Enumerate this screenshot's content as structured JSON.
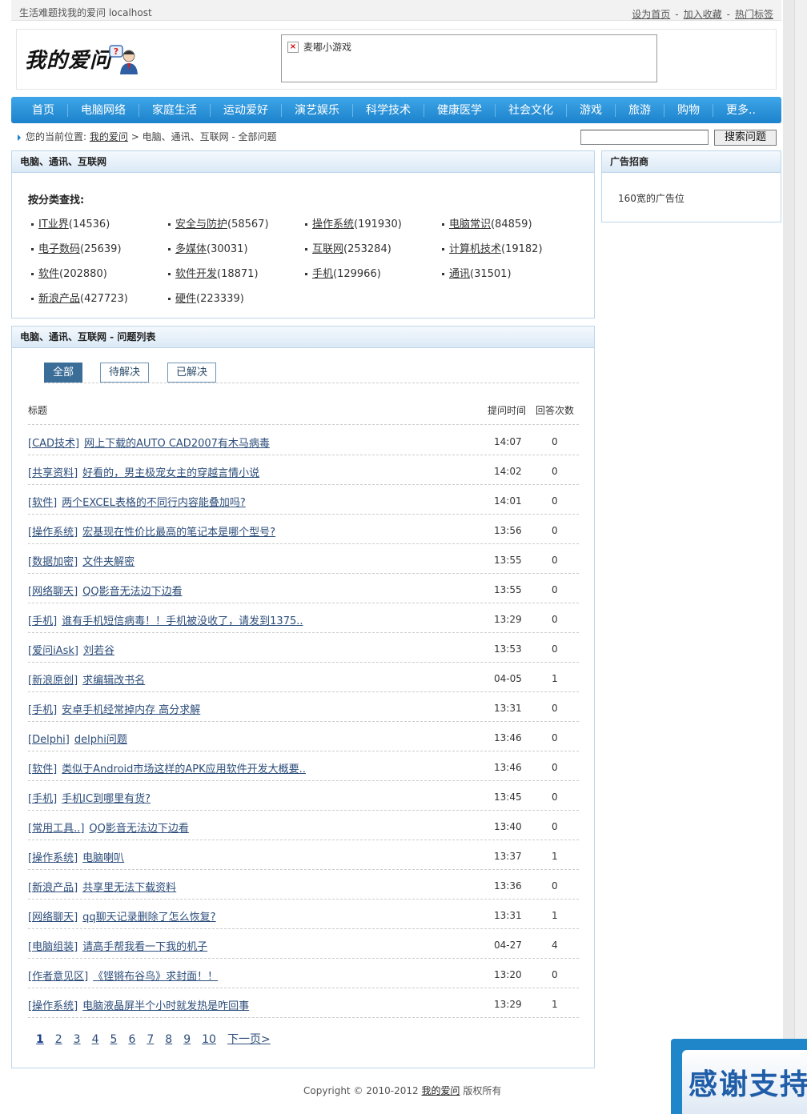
{
  "topbar": {
    "site_tagline": "生活难题找我的爱问  localhost",
    "links": [
      "设为首页",
      "加入收藏",
      "热门标签"
    ],
    "sep": "-"
  },
  "header": {
    "logo_text": "我的爱问",
    "ad_text": "麦嘟小游戏"
  },
  "nav": [
    "首页",
    "电脑网络",
    "家庭生活",
    "运动爱好",
    "演艺娱乐",
    "科学技术",
    "健康医学",
    "社会文化",
    "游戏",
    "旅游",
    "购物",
    "更多.."
  ],
  "breadcrumb": {
    "prefix": "您的当前位置:",
    "home": "我的爱问",
    "rest": " > 电脑、通讯、互联网 - 全部问题"
  },
  "search": {
    "button": "搜索问题",
    "value": ""
  },
  "category_panel": {
    "title": "电脑、通讯、互联网",
    "subtitle": "按分类查找:",
    "items": [
      {
        "name": "IT业界",
        "count": "(14536)"
      },
      {
        "name": "安全与防护",
        "count": "(58567)"
      },
      {
        "name": "操作系统",
        "count": "(191930)"
      },
      {
        "name": "电脑常识",
        "count": "(84859)"
      },
      {
        "name": "电子数码",
        "count": "(25639)"
      },
      {
        "name": "多媒体",
        "count": "(30031)"
      },
      {
        "name": "互联网",
        "count": "(253284)"
      },
      {
        "name": "计算机技术",
        "count": "(19182)"
      },
      {
        "name": "软件",
        "count": "(202880)"
      },
      {
        "name": "软件开发",
        "count": "(18871)"
      },
      {
        "name": "手机",
        "count": "(129966)"
      },
      {
        "name": "通讯",
        "count": "(31501)"
      },
      {
        "name": "新浪产品",
        "count": "(427723)"
      },
      {
        "name": "硬件",
        "count": "(223339)"
      }
    ]
  },
  "ad_panel": {
    "title": "广告招商",
    "body": "160宽的广告位"
  },
  "list_panel": {
    "title": "电脑、通讯、互联网  - 问题列表",
    "tabs": [
      "全部",
      "待解决",
      "已解决"
    ],
    "columns": [
      "标题",
      "提问时间",
      "回答次数"
    ],
    "rows": [
      {
        "cat": "[CAD技术]",
        "title": "网上下载的AUTO CAD2007有木马病毒",
        "time": "14:07",
        "count": "0"
      },
      {
        "cat": "[共享资料]",
        "title": "好看的，男主极宠女主的穿越言情小说",
        "time": "14:02",
        "count": "0"
      },
      {
        "cat": "[软件]",
        "title": "两个EXCEL表格的不同行内容能叠加吗?",
        "time": "14:01",
        "count": "0"
      },
      {
        "cat": "[操作系统]",
        "title": "宏基现在性价比最高的笔记本是哪个型号?",
        "time": "13:56",
        "count": "0"
      },
      {
        "cat": "[数据加密]",
        "title": "文件夹解密",
        "time": "13:55",
        "count": "0"
      },
      {
        "cat": "[网络聊天]",
        "title": "QQ影音无法边下边看",
        "time": "13:55",
        "count": "0"
      },
      {
        "cat": "[手机]",
        "title": "谁有手机短信病毒！！手机被没收了，请发到1375..",
        "time": "13:29",
        "count": "0"
      },
      {
        "cat": "[爱问iAsk]",
        "title": "刘若谷",
        "time": "13:53",
        "count": "0"
      },
      {
        "cat": "[新浪原创]",
        "title": "求编辑改书名",
        "time": "04-05",
        "count": "1"
      },
      {
        "cat": "[手机]",
        "title": "安卓手机经常掉内存  高分求解",
        "time": "13:31",
        "count": "0"
      },
      {
        "cat": "[Delphi]",
        "title": "delphi问题",
        "time": "13:46",
        "count": "0"
      },
      {
        "cat": "[软件]",
        "title": "类似于Android市场这样的APK应用软件开发大概要..",
        "time": "13:46",
        "count": "0"
      },
      {
        "cat": "[手机]",
        "title": "手机IC到哪里有货?",
        "time": "13:45",
        "count": "0"
      },
      {
        "cat": "[常用工具..]",
        "title": "QQ影音无法边下边看",
        "time": "13:40",
        "count": "0"
      },
      {
        "cat": "[操作系统]",
        "title": "电脑喇叭",
        "time": "13:37",
        "count": "1"
      },
      {
        "cat": "[新浪产品]",
        "title": "共享里无法下载资料",
        "time": "13:36",
        "count": "0"
      },
      {
        "cat": "[网络聊天]",
        "title": "qq聊天记录删除了怎么恢复?",
        "time": "13:31",
        "count": "1"
      },
      {
        "cat": "[电脑组装]",
        "title": "请高手帮我看一下我的机子",
        "time": "04-27",
        "count": "4"
      },
      {
        "cat": "[作者意见区]",
        "title": "《铿锵布谷鸟》求封面！！",
        "time": "13:20",
        "count": "0"
      },
      {
        "cat": "[操作系统]",
        "title": "电脑液晶屏半个小时就发热是咋回事",
        "time": "13:29",
        "count": "1"
      }
    ],
    "pager": [
      "1",
      "2",
      "3",
      "4",
      "5",
      "6",
      "7",
      "8",
      "9",
      "10",
      "下一页>"
    ]
  },
  "footer": {
    "prefix": "Copyright © 2010-2012 ",
    "link": "我的爱问",
    "suffix": "  版权所有"
  },
  "float_banner": {
    "text": "感谢支持"
  },
  "colors": {
    "nav_blue": "#1c82cc",
    "link": "#2c4d7a",
    "tab_active": "#3b6d99"
  }
}
